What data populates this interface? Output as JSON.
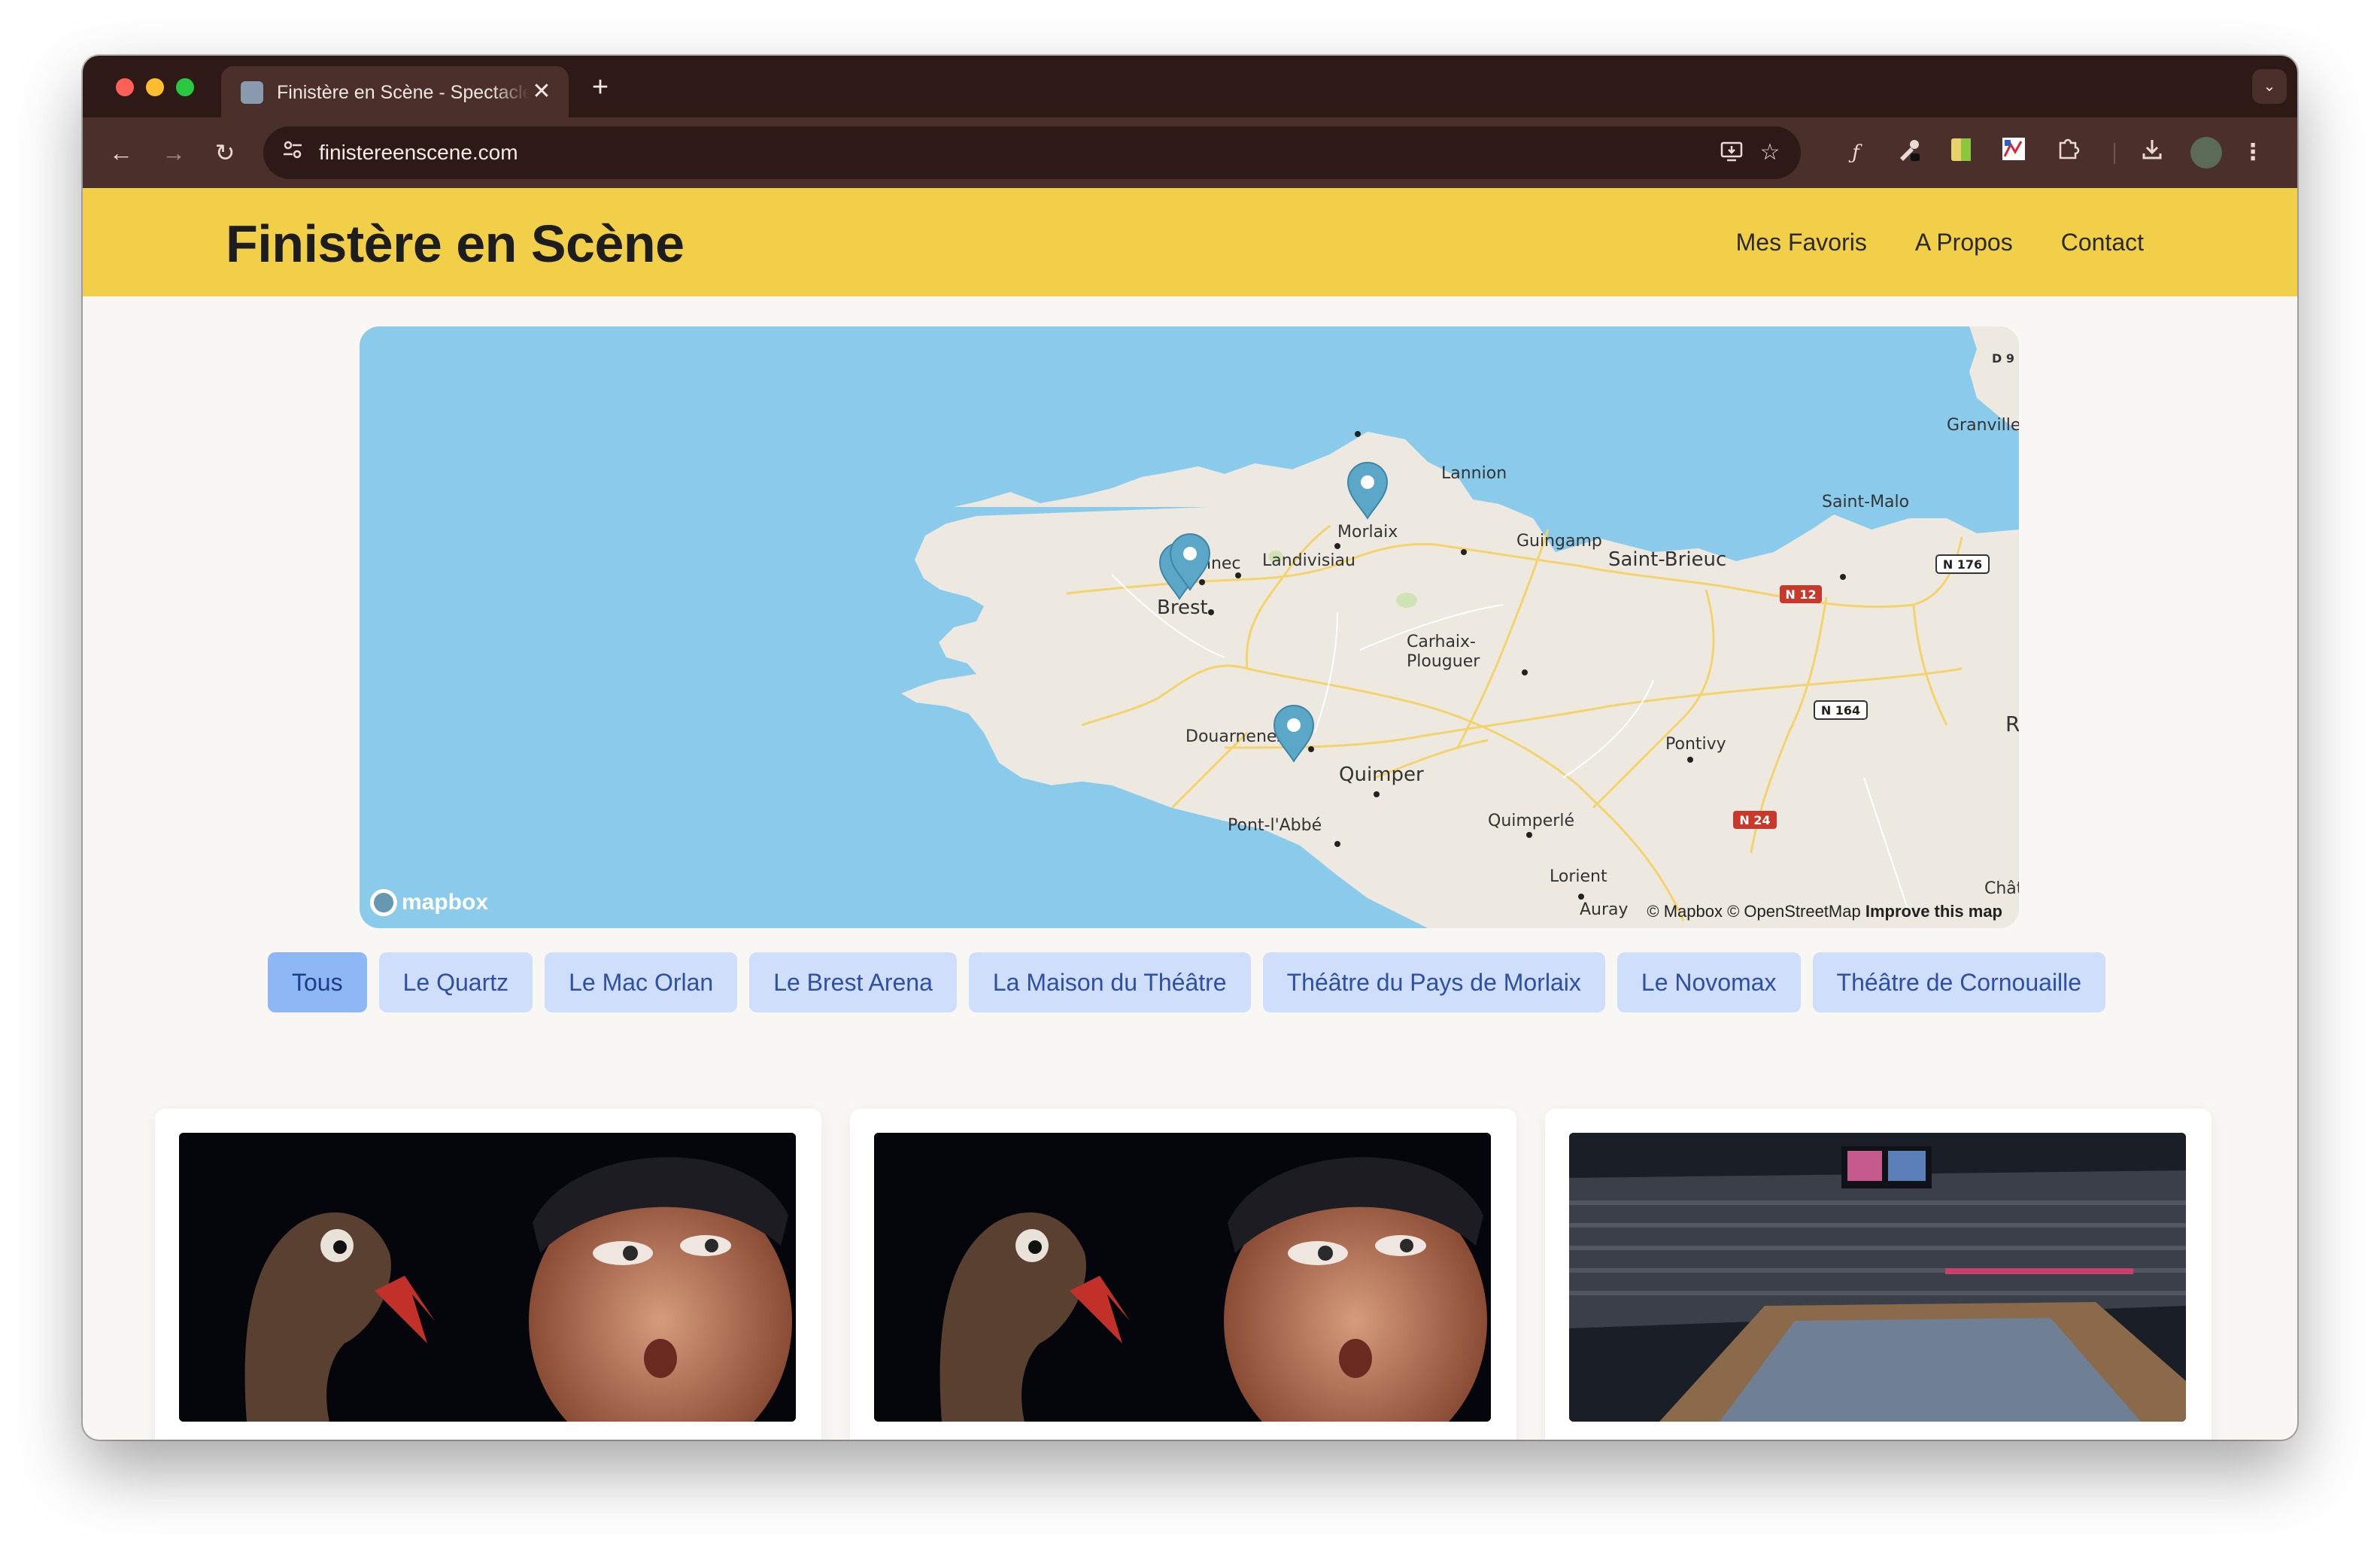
{
  "browser": {
    "tab_title": "Finistère en Scène - Spectacles",
    "tab_close": "✕",
    "new_tab": "+",
    "tab_menu": "⌄",
    "url": "finistereenscene.com",
    "nav": {
      "back": "←",
      "forward": "→",
      "reload": "↻"
    }
  },
  "site": {
    "brand": "Finistère en Scène",
    "nav": [
      {
        "label": "Mes Favoris"
      },
      {
        "label": "A Propos"
      },
      {
        "label": "Contact"
      }
    ]
  },
  "map": {
    "places": {
      "lannion": "Lannion",
      "morlaix": "Morlaix",
      "guingamp": "Guingamp",
      "landivisiau": "Landivisiau",
      "saint_brieuc": "Saint-Brieuc",
      "saint_malo": "Saint-Malo",
      "granville": "Granville",
      "brest": "Brest",
      "landerneau": "nnec",
      "carhaix1": "Carhaix-",
      "carhaix2": "Plouguer",
      "douarnenez": "Douarnenez",
      "quimper": "Quimper",
      "pont_labbe": "Pont-l'Abbé",
      "quimperle": "Quimperlé",
      "lorient": "Lorient",
      "pontivy": "Pontivy",
      "rennes": "Rennes",
      "auray": "Auray",
      "chat": "Chât",
      "d9": "D 9"
    },
    "roads": {
      "n12": "N 12",
      "n176": "N 176",
      "n164": "N 164",
      "n24": "N 24"
    },
    "logo": "mapbox",
    "attribution": "© Mapbox © OpenStreetMap",
    "improve": "Improve this map"
  },
  "filters": [
    {
      "label": "Tous",
      "active": true
    },
    {
      "label": "Le Quartz"
    },
    {
      "label": "Le Mac Orlan"
    },
    {
      "label": "Le Brest Arena"
    },
    {
      "label": "La Maison du Théâtre"
    },
    {
      "label": "Théâtre du Pays de Morlaix"
    },
    {
      "label": "Le Novomax"
    },
    {
      "label": "Théâtre de Cornouaille"
    }
  ],
  "colors": {
    "header": "#f2cf48",
    "sea": "#8acbec",
    "chip": "#cfdffb",
    "chip_active": "#8db8f5",
    "marker": "#5ba7c7"
  }
}
